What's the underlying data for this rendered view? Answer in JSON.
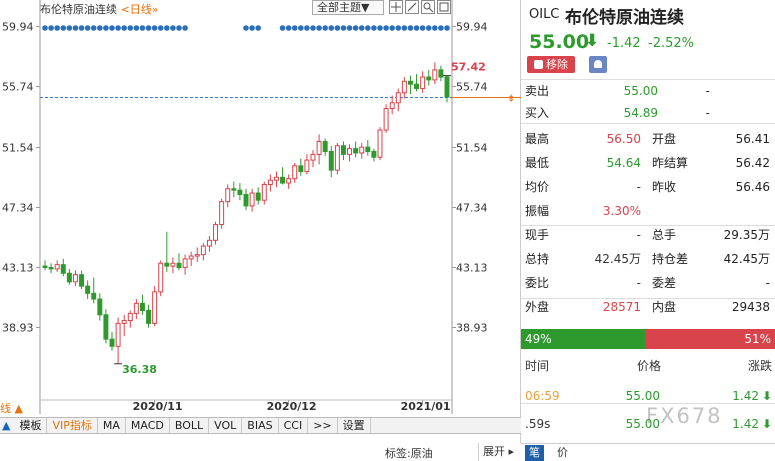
{
  "chart_header": {
    "title": "布伦特原油连续",
    "period": "<日线»",
    "theme_select": "全部主题▼"
  },
  "zoom_link": "线 ▲",
  "indicator_bar": {
    "lead": "▲",
    "items": [
      "模板",
      "VIP指标",
      "MA",
      "MACD",
      "BOLL",
      "VOL",
      "BIAS",
      "CCI",
      ">>",
      "设置"
    ]
  },
  "status_bar": {
    "tag": "标签:原油",
    "expand": "展开 ▸"
  },
  "chart_data": {
    "type": "candlestick",
    "title": "布伦特原油连续",
    "ylim": [
      34.2,
      60.8
    ],
    "y_ticks": [
      "59.94",
      "55.74",
      "51.54",
      "47.34",
      "43.13",
      "38.93"
    ],
    "x_ticks": [
      {
        "label": "2020/11",
        "index": 18
      },
      {
        "label": "2020/12",
        "index": 40
      },
      {
        "label": "2021/01",
        "index": 62
      }
    ],
    "current_price_line": 55.0,
    "annotations": [
      {
        "label": "57.42",
        "type": "high",
        "index": 66
      },
      {
        "label": "36.38",
        "type": "low",
        "index": 12
      }
    ],
    "colors": {
      "up": "#d9434b",
      "down": "#2e9a2e",
      "dash": "#3a7bd5",
      "dot": "#2a6fb8"
    },
    "candles": [
      [
        43.2,
        43.6,
        42.9,
        43.1
      ],
      [
        43.1,
        43.4,
        42.7,
        43.0
      ],
      [
        43.0,
        43.6,
        42.8,
        43.3
      ],
      [
        43.3,
        43.7,
        42.5,
        42.7
      ],
      [
        42.7,
        43.0,
        41.9,
        42.1
      ],
      [
        42.1,
        42.9,
        41.8,
        42.6
      ],
      [
        42.6,
        42.9,
        41.6,
        41.8
      ],
      [
        41.8,
        42.2,
        40.9,
        41.3
      ],
      [
        41.3,
        42.4,
        40.6,
        40.9
      ],
      [
        40.9,
        41.3,
        39.4,
        39.8
      ],
      [
        39.8,
        40.2,
        37.8,
        38.1
      ],
      [
        38.1,
        38.6,
        37.3,
        37.6
      ],
      [
        37.6,
        39.6,
        36.38,
        39.2
      ],
      [
        39.2,
        39.8,
        38.3,
        39.4
      ],
      [
        39.4,
        40.1,
        38.9,
        39.9
      ],
      [
        39.9,
        40.9,
        39.5,
        40.6
      ],
      [
        40.6,
        41.2,
        39.8,
        40.1
      ],
      [
        40.1,
        40.5,
        38.9,
        39.2
      ],
      [
        39.2,
        41.8,
        39.0,
        41.4
      ],
      [
        41.4,
        43.6,
        41.1,
        43.4
      ],
      [
        43.4,
        45.6,
        42.8,
        43.2
      ],
      [
        43.2,
        43.8,
        42.7,
        43.4
      ],
      [
        43.4,
        44.1,
        42.9,
        43.1
      ],
      [
        43.1,
        44.0,
        42.6,
        43.7
      ],
      [
        43.7,
        44.2,
        43.2,
        43.9
      ],
      [
        43.9,
        44.5,
        43.5,
        44.0
      ],
      [
        44.0,
        44.8,
        43.6,
        44.6
      ],
      [
        44.6,
        45.3,
        44.2,
        45.0
      ],
      [
        45.0,
        46.3,
        44.7,
        46.1
      ],
      [
        46.1,
        47.9,
        45.8,
        47.7
      ],
      [
        47.7,
        48.9,
        47.3,
        48.6
      ],
      [
        48.6,
        49.1,
        48.0,
        48.5
      ],
      [
        48.5,
        49.0,
        47.8,
        48.2
      ],
      [
        48.2,
        48.6,
        47.1,
        47.4
      ],
      [
        47.4,
        48.6,
        47.0,
        48.3
      ],
      [
        48.3,
        48.7,
        47.5,
        47.8
      ],
      [
        47.8,
        49.1,
        47.5,
        48.9
      ],
      [
        48.9,
        49.6,
        48.4,
        49.2
      ],
      [
        49.2,
        49.8,
        48.7,
        49.4
      ],
      [
        49.4,
        50.1,
        48.9,
        49.0
      ],
      [
        49.0,
        49.6,
        48.6,
        49.3
      ],
      [
        49.3,
        50.4,
        49.0,
        50.2
      ],
      [
        50.2,
        50.7,
        49.5,
        49.8
      ],
      [
        49.8,
        51.0,
        49.6,
        50.6
      ],
      [
        50.6,
        51.3,
        50.1,
        51.0
      ],
      [
        51.0,
        52.4,
        50.3,
        51.9
      ],
      [
        51.9,
        52.1,
        50.9,
        51.2
      ],
      [
        51.2,
        51.6,
        49.4,
        49.9
      ],
      [
        49.9,
        51.8,
        49.6,
        51.6
      ],
      [
        51.6,
        51.9,
        50.6,
        51.0
      ],
      [
        51.0,
        51.7,
        50.5,
        51.4
      ],
      [
        51.4,
        51.9,
        50.8,
        51.1
      ],
      [
        51.1,
        51.8,
        50.7,
        51.5
      ],
      [
        51.5,
        52.0,
        50.9,
        51.2
      ],
      [
        51.2,
        51.4,
        50.5,
        50.8
      ],
      [
        50.8,
        52.9,
        50.6,
        52.7
      ],
      [
        52.7,
        54.5,
        52.5,
        54.2
      ],
      [
        54.2,
        55.1,
        53.8,
        54.6
      ],
      [
        54.6,
        55.6,
        54.0,
        55.3
      ],
      [
        55.3,
        56.4,
        54.9,
        56.1
      ],
      [
        56.1,
        56.5,
        55.2,
        55.9
      ],
      [
        55.9,
        56.6,
        55.4,
        55.6
      ],
      [
        55.6,
        56.8,
        55.3,
        56.4
      ],
      [
        56.4,
        56.9,
        55.8,
        56.2
      ],
      [
        56.2,
        57.42,
        55.9,
        56.9
      ],
      [
        56.9,
        57.2,
        56.1,
        56.4
      ],
      [
        56.41,
        56.5,
        54.64,
        55.0
      ]
    ]
  },
  "quote": {
    "symbol": "OILC",
    "name": "布伦特原油连续",
    "price": "55.00",
    "arrow": "⬇",
    "change": "-1.42",
    "change_pct": "-2.52%",
    "remove_label": "移除",
    "book": [
      {
        "label": "卖出",
        "price": "55.00",
        "vol": "-"
      },
      {
        "label": "买入",
        "price": "54.89",
        "vol": "-"
      }
    ],
    "stats": [
      {
        "l1": "最高",
        "v1": "56.50",
        "c1": "red",
        "l2": "开盘",
        "v2": "56.41"
      },
      {
        "l1": "最低",
        "v1": "54.64",
        "c1": "green",
        "l2": "昨结算",
        "v2": "56.42"
      },
      {
        "l1": "均价",
        "v1": "-",
        "c1": "",
        "l2": "昨收",
        "v2": "56.46"
      },
      {
        "l1": "振幅",
        "v1": "3.30%",
        "c1": "red",
        "l2": "",
        "v2": ""
      },
      {
        "l1": "现手",
        "v1": "-",
        "c1": "",
        "l2": "总手",
        "v2": "29.35万"
      },
      {
        "l1": "总持",
        "v1": "42.45万",
        "c1": "",
        "l2": "持仓差",
        "v2": "42.45万"
      },
      {
        "l1": "委比",
        "v1": "-",
        "c1": "",
        "l2": "委差",
        "v2": "-"
      },
      {
        "l1": "外盘",
        "v1": "28571",
        "c1": "red",
        "l2": "内盘",
        "v2": "29438"
      }
    ],
    "ratio": {
      "buy_label": "49%",
      "buy_pct": 49,
      "sell_label": "51%"
    },
    "ticks_header": {
      "time": "时间",
      "price": "价格",
      "change": "涨跌"
    },
    "ticks": [
      {
        "time": "06:59",
        "price": "55.00",
        "change": "1.42",
        "time_color": "#e8a33b"
      },
      {
        "time": ".59s",
        "price": "55.00",
        "change": "1.42",
        "time_color": "#333"
      }
    ],
    "watermark": "FX678",
    "footer_tabs": [
      "笔",
      "价"
    ]
  }
}
